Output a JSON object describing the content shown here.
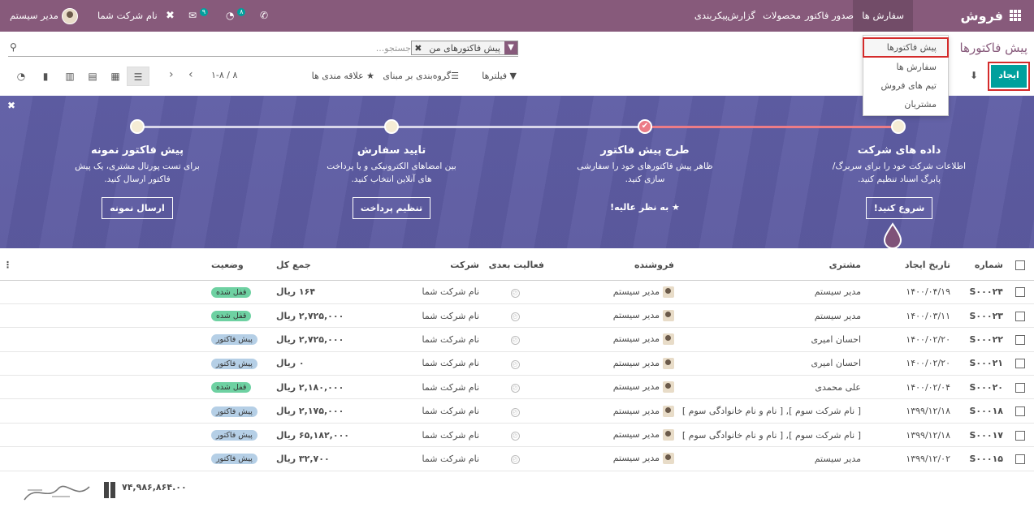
{
  "navbar": {
    "app_name": "فروش",
    "menus": [
      "سفارش ها",
      "صدور فاکتور",
      "محصولات",
      "گزارش",
      "پیکربندی"
    ],
    "company": "نام شرکت شما",
    "user": "مدیر سیستم",
    "messages_count": "۹",
    "activities_count": "۸"
  },
  "dropdown": {
    "items": [
      "پیش فاکتورها",
      "سفارش ها",
      "تیم های فروش",
      "مشتریان"
    ]
  },
  "control_panel": {
    "breadcrumb": "پیش فاکتورها",
    "create_label": "ایجاد",
    "search_facet": "پیش فاکتورهای من",
    "search_placeholder": "جستجو...",
    "filters_label": "فیلترها",
    "groupby_label": "گروه‌بندی بر مبنای",
    "favorites_label": "علاقه مندی ها",
    "pager": "۱-۸ / ۸"
  },
  "banner": {
    "steps": [
      {
        "title": "داده های شرکت",
        "desc": "اطلاعات شرکت خود را برای سربرگ/ پابرگ اسناد تنظیم کنید.",
        "button": "شروع کنید!"
      },
      {
        "title": "طرح پیش فاکتور",
        "desc": "ظاهر پیش فاکتورهای خود را سفارشی سازی کنید.",
        "link": "به نظر عالیه!"
      },
      {
        "title": "تایید سفارش",
        "desc": "بین امضاهای الکترونیکی و یا پرداخت های آنلاین انتخاب کنید.",
        "button": "تنظیم پرداخت"
      },
      {
        "title": "پیش فاکتور نمونه",
        "desc": "برای تست پورتال مشتری، یک پیش فاکتور ارسال کنید.",
        "button": "ارسال نمونه"
      }
    ]
  },
  "table": {
    "headers": {
      "number": "شماره",
      "date": "تاریخ ایجاد",
      "customer": "مشتری",
      "salesperson": "فروشنده",
      "activity": "فعالیت بعدی",
      "company": "شرکت",
      "total": "جمع کل",
      "state": "وضعیت"
    },
    "rows": [
      {
        "number": "S۰۰۰۲۴",
        "date": "۱۴۰۰/۰۴/۱۹",
        "customer": "مدیر سیستم",
        "salesperson": "مدیر سیستم",
        "company": "نام شرکت شما",
        "total": "۱۶۴ ریال",
        "state": "قفل شده",
        "state_kind": "locked"
      },
      {
        "number": "S۰۰۰۲۳",
        "date": "۱۴۰۰/۰۳/۱۱",
        "customer": "مدیر سیستم",
        "salesperson": "مدیر سیستم",
        "company": "نام شرکت شما",
        "total": "۲,۷۲۵,۰۰۰ ریال",
        "state": "قفل شده",
        "state_kind": "locked"
      },
      {
        "number": "S۰۰۰۲۲",
        "date": "۱۴۰۰/۰۲/۲۰",
        "customer": "احسان امیری",
        "salesperson": "مدیر سیستم",
        "company": "نام شرکت شما",
        "total": "۲,۷۲۵,۰۰۰ ریال",
        "state": "پیش فاکتور",
        "state_kind": "quote"
      },
      {
        "number": "S۰۰۰۲۱",
        "date": "۱۴۰۰/۰۲/۲۰",
        "customer": "احسان امیری",
        "salesperson": "مدیر سیستم",
        "company": "نام شرکت شما",
        "total": "۰ ریال",
        "state": "پیش فاکتور",
        "state_kind": "quote"
      },
      {
        "number": "S۰۰۰۲۰",
        "date": "۱۴۰۰/۰۲/۰۴",
        "customer": "علی محمدی",
        "salesperson": "مدیر سیستم",
        "company": "نام شرکت شما",
        "total": "۲,۱۸۰,۰۰۰ ریال",
        "state": "قفل شده",
        "state_kind": "locked"
      },
      {
        "number": "S۰۰۰۱۸",
        "date": "۱۳۹۹/۱۲/۱۸",
        "customer": "[ نام شرکت سوم ], [ نام و نام خانوادگی سوم ]",
        "salesperson": "مدیر سیستم",
        "company": "نام شرکت شما",
        "total": "۲,۱۷۵,۰۰۰ ریال",
        "state": "پیش فاکتور",
        "state_kind": "quote"
      },
      {
        "number": "S۰۰۰۱۷",
        "date": "۱۳۹۹/۱۲/۱۸",
        "customer": "[ نام شرکت سوم ], [ نام و نام خانوادگی سوم ]",
        "salesperson": "مدیر سیستم",
        "company": "نام شرکت شما",
        "total": "۶۵,۱۸۲,۰۰۰ ریال",
        "state": "پیش فاکتور",
        "state_kind": "quote"
      },
      {
        "number": "S۰۰۰۱۵",
        "date": "۱۳۹۹/۱۲/۰۲",
        "customer": "مدیر سیستم",
        "salesperson": "مدیر سیستم",
        "company": "نام شرکت شما",
        "total": "۳۲,۷۰۰ ریال",
        "state": "پیش فاکتور",
        "state_kind": "quote"
      }
    ],
    "grand_total": "۷۴,۹۸۶,۸۶۴.۰۰"
  },
  "colors": {
    "navbar": "#875a7b",
    "primary_button": "#00a09d",
    "highlight": "#d42b2b",
    "banner": "#5f5ea5",
    "locked_badge": "#6ed1a2",
    "quote_badge": "#b5cfe6"
  }
}
